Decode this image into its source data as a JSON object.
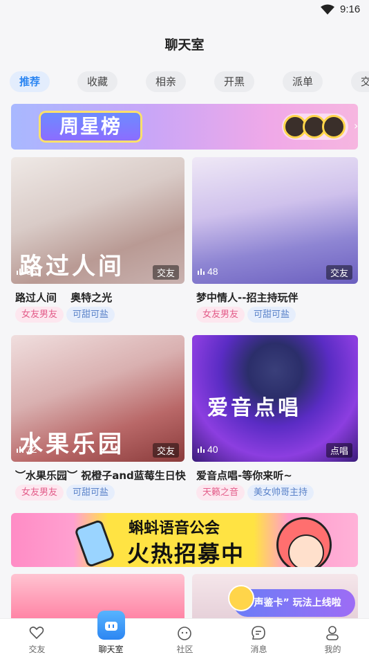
{
  "status": {
    "time": "9:16"
  },
  "header": {
    "title": "聊天室"
  },
  "tabs": [
    {
      "label": "推荐",
      "active": true
    },
    {
      "label": "收藏"
    },
    {
      "label": "相亲"
    },
    {
      "label": "开黑"
    },
    {
      "label": "派单"
    },
    {
      "label": "交"
    }
  ],
  "banner_top": {
    "title": "周星榜"
  },
  "banner_mid": {
    "line1": "蝌蚪语音公会",
    "line2": "火热招募中"
  },
  "rooms": [
    {
      "name": "路过人间　 奥特之光",
      "count": "85",
      "type": "交友",
      "overlay": "路过人间",
      "tags": [
        "女友男友",
        "可甜可盐"
      ]
    },
    {
      "name": "梦中情人--招主持玩伴",
      "count": "48",
      "type": "交友",
      "overlay": "",
      "tags": [
        "女友男友",
        "可甜可盐"
      ]
    },
    {
      "name": "︶水果乐园︶ 祝橙子and蓝莓生日快...",
      "count": "72",
      "type": "交友",
      "overlay": "水果乐园",
      "tags": [
        "女友男友",
        "可甜可盐"
      ]
    },
    {
      "name": "爱音点唱-等你来听~",
      "count": "40",
      "type": "点唱",
      "overlay": "爱音点唱",
      "tags": [
        "天籁之音",
        "美女帅哥主持"
      ]
    }
  ],
  "promo": {
    "label": "“声鉴卡” 玩法上线啦"
  },
  "nav": [
    {
      "label": "交友",
      "icon": "heart-icon"
    },
    {
      "label": "聊天室",
      "icon": "chat-room-icon",
      "active": true
    },
    {
      "label": "社区",
      "icon": "community-icon"
    },
    {
      "label": "消息",
      "icon": "message-icon"
    },
    {
      "label": "我的",
      "icon": "profile-icon"
    }
  ],
  "colors": {
    "accent": "#2c86f2",
    "tag_pink": "#e35d8a",
    "tag_blue": "#5b83c9"
  }
}
